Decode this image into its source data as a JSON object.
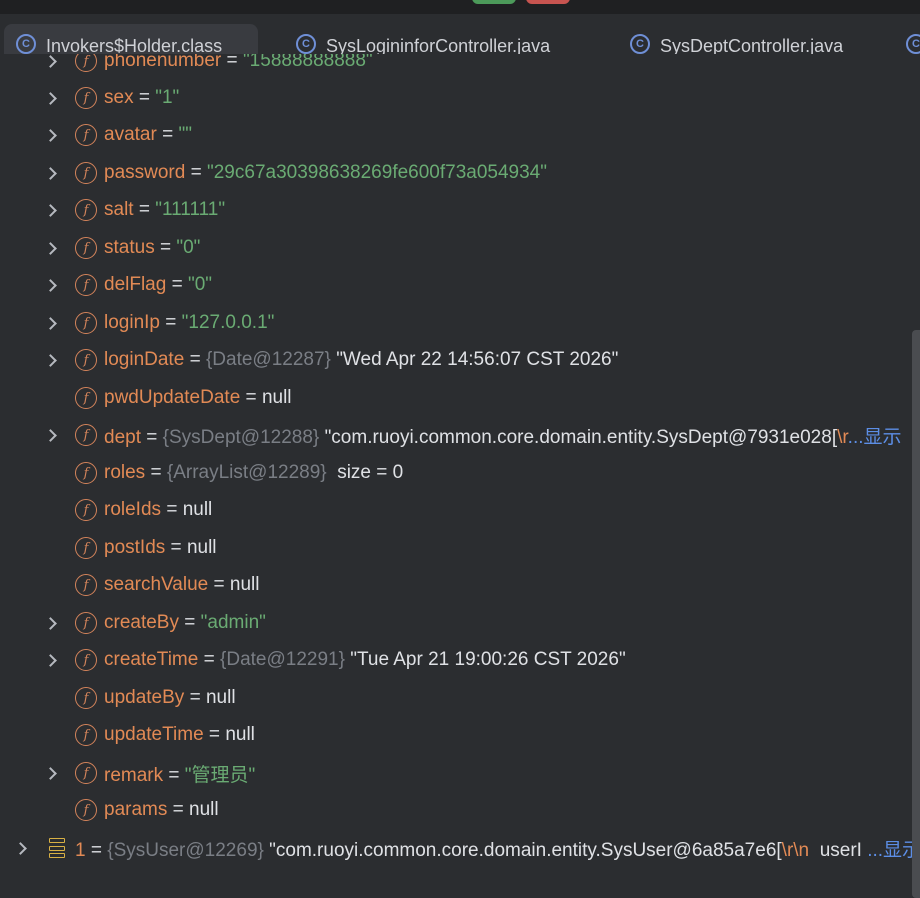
{
  "tabs": [
    {
      "label": "Invokers$Holder.class",
      "icon": "class-file-icon"
    },
    {
      "label": "SysLogininforController.java",
      "icon": "java-class-icon"
    },
    {
      "label": "SysDeptController.java",
      "icon": "java-class-icon"
    }
  ],
  "fields": [
    {
      "name": "phonenumber",
      "eq": "=",
      "value": "\"15888888888\""
    },
    {
      "name": "sex",
      "eq": "=",
      "value": "\"1\""
    },
    {
      "name": "avatar",
      "eq": "=",
      "value": "\"\""
    },
    {
      "name": "password",
      "eq": "=",
      "value": "\"29c67a30398638269fe600f73a054934\""
    },
    {
      "name": "salt",
      "eq": "=",
      "value": "\"111111\""
    },
    {
      "name": "status",
      "eq": "=",
      "value": "\"0\""
    },
    {
      "name": "delFlag",
      "eq": "=",
      "value": "\"0\""
    },
    {
      "name": "loginIp",
      "eq": "=",
      "value": "\"127.0.0.1\""
    },
    {
      "name": "loginDate",
      "eq": "=",
      "ref": "{Date@12287}",
      "value": "\"Wed Apr 22 14:56:07 CST 2026\""
    },
    {
      "name": "pwdUpdateDate",
      "eq": "=",
      "value": "null"
    },
    {
      "name": "dept",
      "eq": "=",
      "ref": "{SysDept@12288}",
      "value": "\"com.ruoyi.common.core.domain.entity.SysDept@7931e028[",
      "escape": "\\r",
      "more": "...显示"
    },
    {
      "name": "roles",
      "eq": "=",
      "ref": "{ArrayList@12289}",
      "value": "size = 0"
    },
    {
      "name": "roleIds",
      "eq": "=",
      "value": "null"
    },
    {
      "name": "postIds",
      "eq": "=",
      "value": "null"
    },
    {
      "name": "searchValue",
      "eq": "=",
      "value": "null"
    },
    {
      "name": "createBy",
      "eq": "=",
      "value": "\"admin\""
    },
    {
      "name": "createTime",
      "eq": "=",
      "ref": "{Date@12291}",
      "value": "\"Tue Apr 21 19:00:26 CST 2026\""
    },
    {
      "name": "updateBy",
      "eq": "=",
      "value": "null"
    },
    {
      "name": "updateTime",
      "eq": "=",
      "value": "null"
    },
    {
      "name": "remark",
      "eq": "=",
      "value": "\"管理员\""
    },
    {
      "name": "params",
      "eq": "=",
      "value": "null"
    }
  ],
  "array_item": {
    "index": "1",
    "eq": "=",
    "ref": "{SysUser@12269}",
    "value": "\"com.ruoyi.common.core.domain.entity.SysUser@6a85a7e6[",
    "escape": "\\r\\n",
    "tail": "userI",
    "more": "...显示"
  },
  "colors": {
    "background": "#2b2d30",
    "field_name": "#e28a55",
    "string_value": "#6aab73",
    "reference": "#7a7e85",
    "link": "#5c8ee6"
  }
}
